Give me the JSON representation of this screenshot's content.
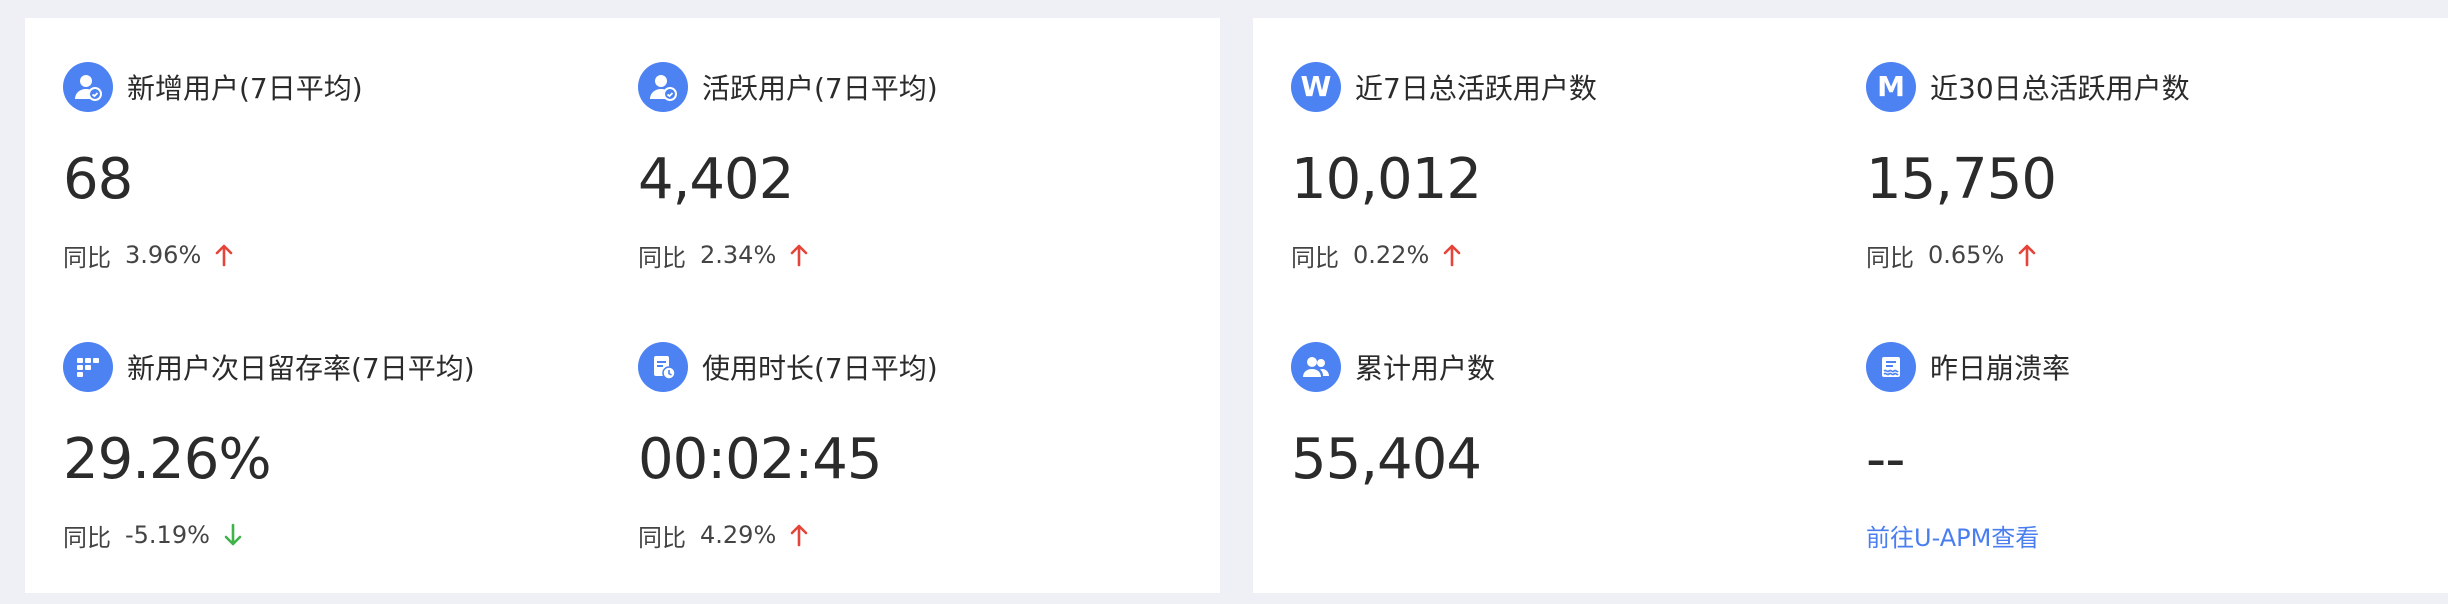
{
  "colors": {
    "accent": "#4c82f2",
    "up": "#e5443a",
    "down": "#3fb34a",
    "link": "#4a7ef0"
  },
  "left_panel": {
    "cards": [
      {
        "title": "新增用户(7日平均)",
        "value": "68",
        "compare_label": "同比",
        "compare_value": "3.96%",
        "trend": "up",
        "icon": "user-add-icon"
      },
      {
        "title": "活跃用户(7日平均)",
        "value": "4,402",
        "compare_label": "同比",
        "compare_value": "2.34%",
        "trend": "up",
        "icon": "user-active-icon"
      },
      {
        "title": "新用户次日留存率(7日平均)",
        "value": "29.26%",
        "compare_label": "同比",
        "compare_value": "-5.19%",
        "trend": "down",
        "icon": "grid-icon"
      },
      {
        "title": "使用时长(7日平均)",
        "value": "00:02:45",
        "compare_label": "同比",
        "compare_value": "4.29%",
        "trend": "up",
        "icon": "time-report-icon"
      }
    ]
  },
  "right_panel": {
    "cards": [
      {
        "title": "近7日总活跃用户数",
        "value": "10,012",
        "compare_label": "同比",
        "compare_value": "0.22%",
        "trend": "up",
        "icon": "w-letter-icon",
        "icon_letter": "W"
      },
      {
        "title": "近30日总活跃用户数",
        "value": "15,750",
        "compare_label": "同比",
        "compare_value": "0.65%",
        "trend": "up",
        "icon": "m-letter-icon",
        "icon_letter": "M"
      },
      {
        "title": "累计用户数",
        "value": "55,404",
        "icon": "users-icon"
      },
      {
        "title": "昨日崩溃率",
        "value": "--",
        "link": "前往U-APM查看",
        "icon": "crash-report-icon"
      }
    ]
  }
}
